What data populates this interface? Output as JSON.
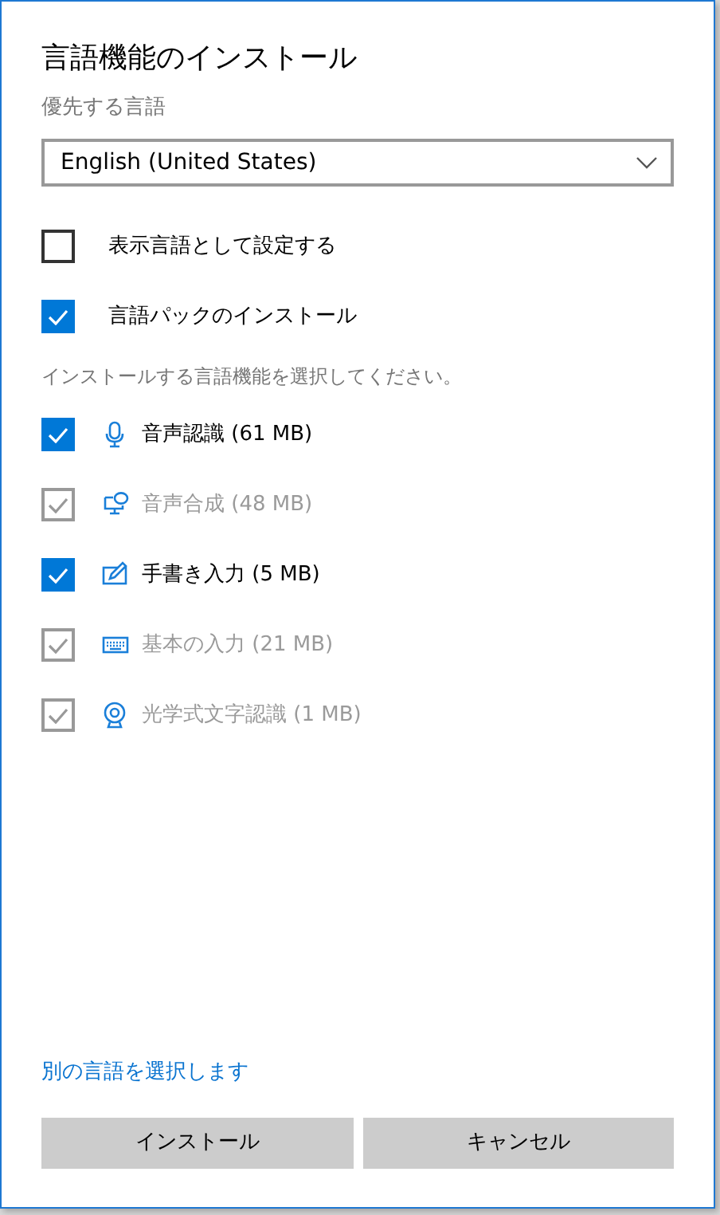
{
  "title": "言語機能のインストール",
  "preferred_label": "優先する言語",
  "language_select": {
    "value": "English (United States)"
  },
  "options": [
    {
      "label": "表示言語として設定する",
      "checked": false
    },
    {
      "label": "言語パックのインストール",
      "checked": true
    }
  ],
  "features_prompt": "インストールする言語機能を選択してください。",
  "features": [
    {
      "label": "音声認識 (61 MB)",
      "kind": "microphone",
      "checked": true,
      "disabled": false
    },
    {
      "label": "音声合成 (48 MB)",
      "kind": "speech",
      "checked": true,
      "disabled": true
    },
    {
      "label": "手書き入力 (5 MB)",
      "kind": "pen",
      "checked": true,
      "disabled": false
    },
    {
      "label": "基本の入力 (21 MB)",
      "kind": "keyboard",
      "checked": true,
      "disabled": true
    },
    {
      "label": "光学式文字認識 (1 MB)",
      "kind": "camera",
      "checked": true,
      "disabled": true
    }
  ],
  "link": "別の言語を選択します",
  "buttons": [
    "インストール",
    "キャンセル"
  ]
}
